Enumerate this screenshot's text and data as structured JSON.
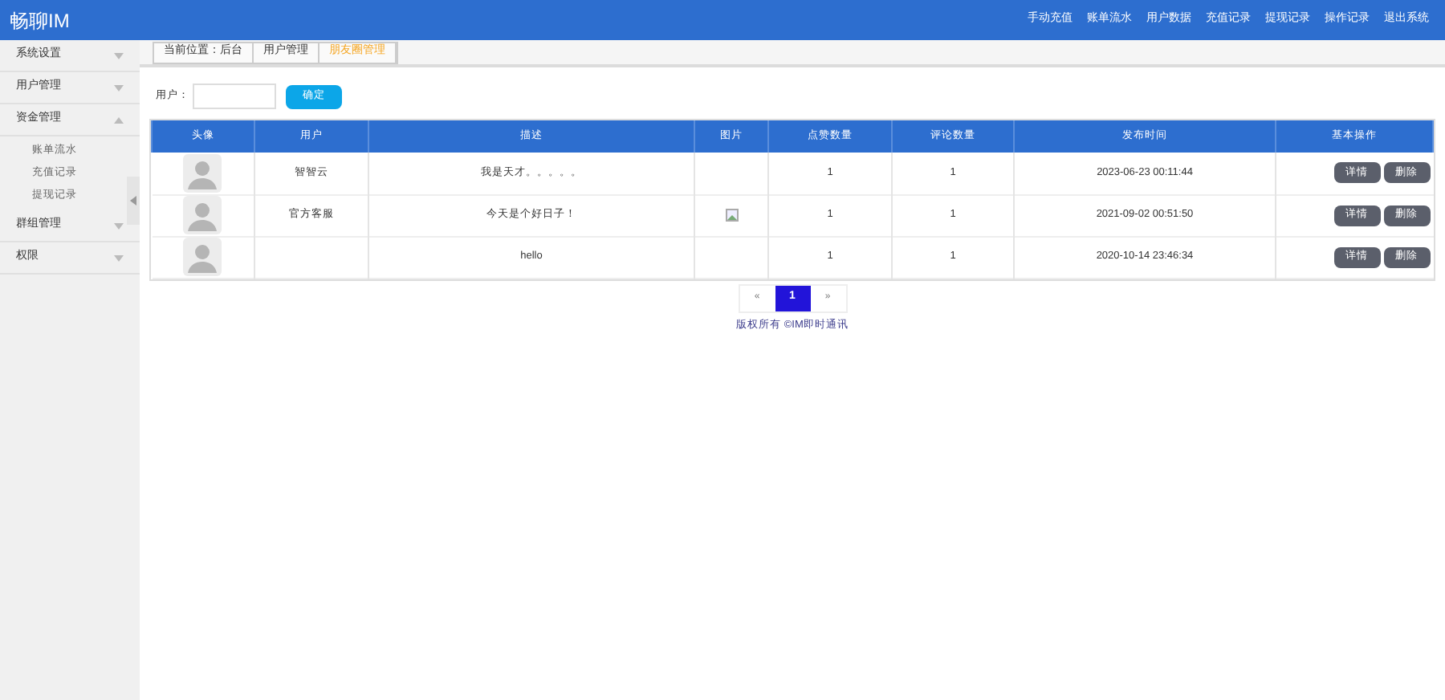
{
  "header": {
    "logo": "畅聊IM",
    "nav": [
      "手动充值",
      "账单流水",
      "用户数据",
      "充值记录",
      "提现记录",
      "操作记录",
      "退出系统"
    ]
  },
  "sidebar": {
    "items": [
      {
        "label": "系统设置",
        "expanded": false
      },
      {
        "label": "用户管理",
        "expanded": false
      },
      {
        "label": "资金管理",
        "expanded": true,
        "children": [
          {
            "label": "账单流水"
          },
          {
            "label": "充值记录"
          },
          {
            "label": "提现记录"
          }
        ]
      },
      {
        "label": "群组管理",
        "expanded": false
      },
      {
        "label": "权限",
        "expanded": false
      }
    ]
  },
  "breadcrumb": [
    {
      "label": "当前位置：后台",
      "selected": false
    },
    {
      "label": "用户管理",
      "selected": false
    },
    {
      "label": "朋友圈管理",
      "selected": true
    }
  ],
  "search": {
    "label": "用户：",
    "button": "确定"
  },
  "table": {
    "columns": [
      "头像",
      "用户",
      "描述",
      "图片",
      "点赞数量",
      "评论数量",
      "发布时间",
      "基本操作"
    ],
    "rows": [
      {
        "user": "智智云",
        "description": "我是天才。。。。。",
        "has_image": false,
        "likes": "1",
        "comments": "1",
        "time": "2023-06-23 00:11:44",
        "actions": [
          "详情",
          "删除"
        ]
      },
      {
        "user": "官方客服",
        "description": "今天是个好日子！",
        "has_image": true,
        "likes": "1",
        "comments": "1",
        "time": "2021-09-02 00:51:50",
        "actions": [
          "详情",
          "删除"
        ]
      },
      {
        "user": "",
        "description": "hello",
        "has_image": false,
        "likes": "1",
        "comments": "1",
        "time": "2020-10-14 23:46:34",
        "actions": [
          "详情",
          "删除"
        ]
      }
    ]
  },
  "pagination": {
    "prev": "«",
    "next": "»",
    "pages": [
      {
        "label": "1",
        "selected": true
      }
    ]
  },
  "footer": "版权所有 ©IM即时通讯"
}
